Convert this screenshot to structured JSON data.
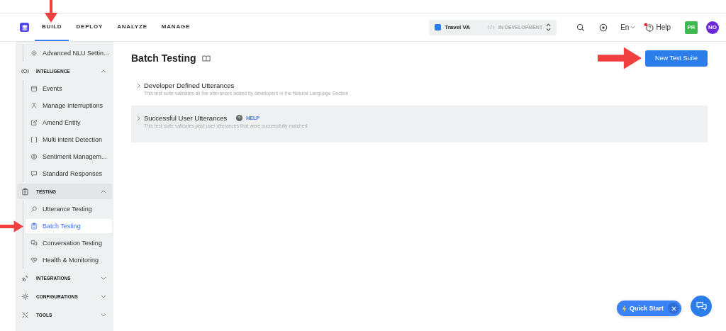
{
  "nav": {
    "tabs": [
      {
        "label": "BUILD",
        "selected": true
      },
      {
        "label": "DEPLOY",
        "selected": false
      },
      {
        "label": "ANALYZE",
        "selected": false
      },
      {
        "label": "MANAGE",
        "selected": false
      }
    ],
    "project": {
      "name": "Travel VA",
      "status": "IN DEVELOPMENT"
    },
    "language": "En",
    "help": "Help",
    "help_notification": true,
    "avatars": [
      {
        "initials": "PR",
        "color": "#3fb950",
        "kind": "square"
      },
      {
        "initials": "NO",
        "color": "#6d28d9",
        "kind": "circle"
      }
    ]
  },
  "sidebar": [
    {
      "kind": "item",
      "label": "Advanced NLU Settin...",
      "selected": false
    },
    {
      "kind": "section",
      "label": "INTELLIGENCE",
      "expanded": true,
      "children": [
        {
          "label": "Events",
          "selected": false
        },
        {
          "label": "Manage Interruptions",
          "selected": false
        },
        {
          "label": "Amend Entity",
          "selected": false
        },
        {
          "label": "Multi intent Detection",
          "selected": false
        },
        {
          "label": "Sentiment Managem...",
          "selected": false
        },
        {
          "label": "Standard Responses",
          "selected": false
        }
      ]
    },
    {
      "kind": "section",
      "label": "TESTING",
      "expanded": true,
      "children": [
        {
          "label": "Utterance Testing",
          "selected": false
        },
        {
          "label": "Batch Testing",
          "selected": true
        },
        {
          "label": "Conversation Testing",
          "selected": false
        },
        {
          "label": "Health & Monitoring",
          "selected": false
        }
      ]
    },
    {
      "kind": "section",
      "label": "INTEGRATIONS",
      "expanded": false
    },
    {
      "kind": "section",
      "label": "CONFIGURATIONS",
      "expanded": false
    },
    {
      "kind": "section",
      "label": "TOOLS",
      "expanded": false
    }
  ],
  "page": {
    "title": "Batch Testing",
    "new_button": "New Test Suite",
    "suites": [
      {
        "title": "Developer Defined Utterances",
        "description": "This test suite validates all the utterances added by developers in the Natural Language Section",
        "selected": false
      },
      {
        "title": "Successful User Utterances",
        "description": "This test suite validates past user utterances that were successfully matched",
        "help": "HELP",
        "selected": true
      }
    ]
  },
  "quick_start": "Quick Start"
}
